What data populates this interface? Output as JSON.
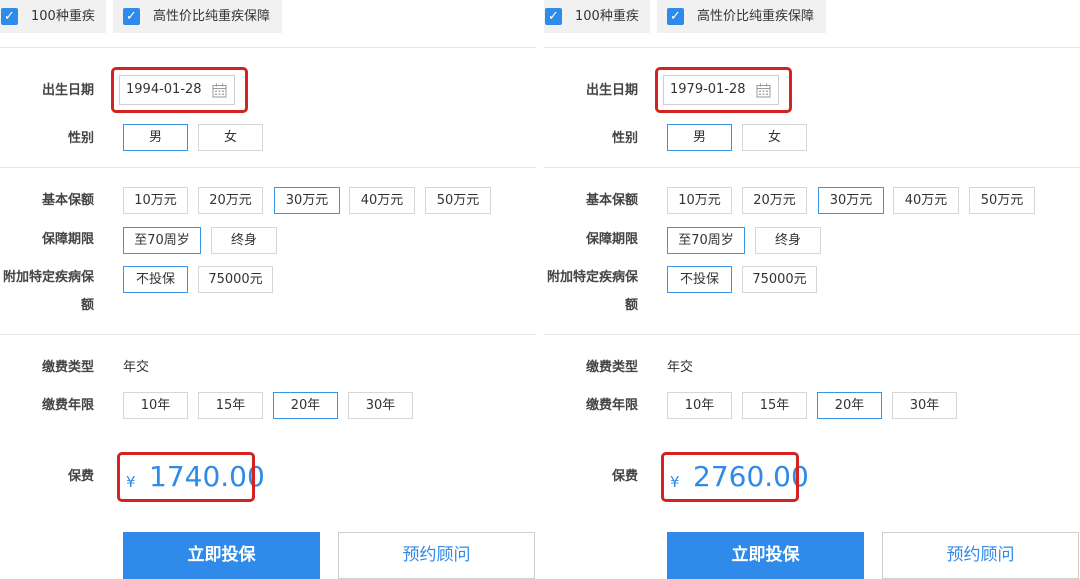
{
  "left": {
    "tags": [
      {
        "label": "100种重疾",
        "checked": true
      },
      {
        "label": "高性价比纯重疾保障",
        "checked": true
      }
    ],
    "birth_label": "出生日期",
    "birth_value": "1994-01-28",
    "gender_label": "性别",
    "gender_options": [
      "男",
      "女"
    ],
    "gender_selected": "男",
    "coverage_label": "基本保额",
    "coverage_options": [
      "10万元",
      "20万元",
      "30万元",
      "40万元",
      "50万元"
    ],
    "coverage_selected": "30万元",
    "term_label": "保障期限",
    "term_options": [
      "至70周岁",
      "终身"
    ],
    "term_selected": "至70周岁",
    "addon_label_line1": "附加特定疾病保",
    "addon_label_line2": "额",
    "addon_options": [
      "不投保",
      "75000元"
    ],
    "addon_selected": "不投保",
    "paytype_label": "缴费类型",
    "paytype_value": "年交",
    "payyears_label": "缴费年限",
    "payyears_options": [
      "10年",
      "15年",
      "20年",
      "30年"
    ],
    "payyears_selected": "20年",
    "premium_label": "保费",
    "currency": "¥",
    "premium_value": "1740.00",
    "buy_label": "立即投保",
    "consult_label": "预约顾问"
  },
  "right": {
    "tags": [
      {
        "label": "100种重疾",
        "checked": true
      },
      {
        "label": "高性价比纯重疾保障",
        "checked": true
      }
    ],
    "birth_label": "出生日期",
    "birth_value": "1979-01-28",
    "gender_label": "性别",
    "gender_options": [
      "男",
      "女"
    ],
    "gender_selected": "男",
    "coverage_label": "基本保额",
    "coverage_options": [
      "10万元",
      "20万元",
      "30万元",
      "40万元",
      "50万元"
    ],
    "coverage_selected": "30万元",
    "term_label": "保障期限",
    "term_options": [
      "至70周岁",
      "终身"
    ],
    "term_selected": "至70周岁",
    "addon_label_line1": "附加特定疾病保",
    "addon_label_line2": "额",
    "addon_options": [
      "不投保",
      "75000元"
    ],
    "addon_selected": "不投保",
    "paytype_label": "缴费类型",
    "paytype_value": "年交",
    "payyears_label": "缴费年限",
    "payyears_options": [
      "10年",
      "15年",
      "20年",
      "30年"
    ],
    "payyears_selected": "20年",
    "premium_label": "保费",
    "currency": "¥",
    "premium_value": "2760.00",
    "buy_label": "立即投保",
    "consult_label": "预约顾问"
  },
  "colors": {
    "accent": "#2f8ae9",
    "highlight": "#d42222",
    "tag_bg": "#f1f1f1"
  },
  "icons": {
    "checkbox": "check-icon",
    "calendar": "calendar-icon"
  }
}
